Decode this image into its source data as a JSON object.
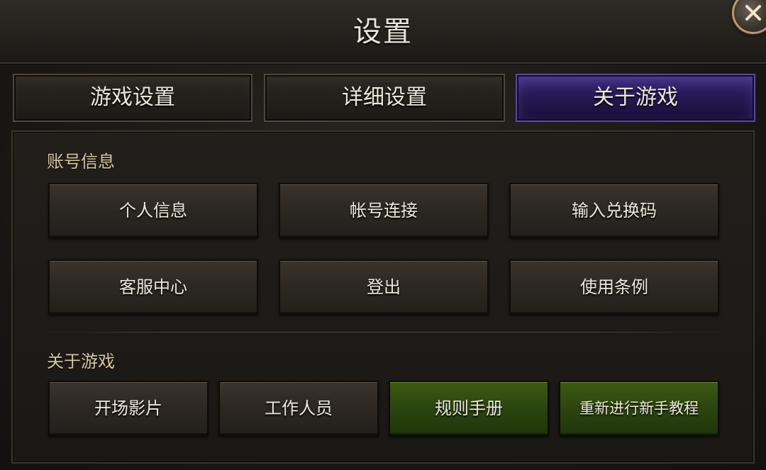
{
  "window": {
    "title": "设置",
    "close_icon": "close-icon"
  },
  "tabs": [
    {
      "label": "游戏设置",
      "active": false
    },
    {
      "label": "详细设置",
      "active": false
    },
    {
      "label": "关于游戏",
      "active": true
    }
  ],
  "colors": {
    "active_tab": "#2a1a5e",
    "green_button": "#2b4510",
    "section_label": "#d8c6a0"
  },
  "account_section": {
    "label": "账号信息",
    "buttons": [
      {
        "label": "个人信息"
      },
      {
        "label": "帐号连接"
      },
      {
        "label": "输入兑换码"
      },
      {
        "label": "客服中心"
      },
      {
        "label": "登出"
      },
      {
        "label": "使用条例"
      }
    ]
  },
  "about_section": {
    "label": "关于游戏",
    "buttons": [
      {
        "label": "开场影片",
        "style": "normal"
      },
      {
        "label": "工作人员",
        "style": "normal"
      },
      {
        "label": "规则手册",
        "style": "green"
      },
      {
        "label": "重新进行新手教程",
        "style": "green"
      }
    ]
  }
}
